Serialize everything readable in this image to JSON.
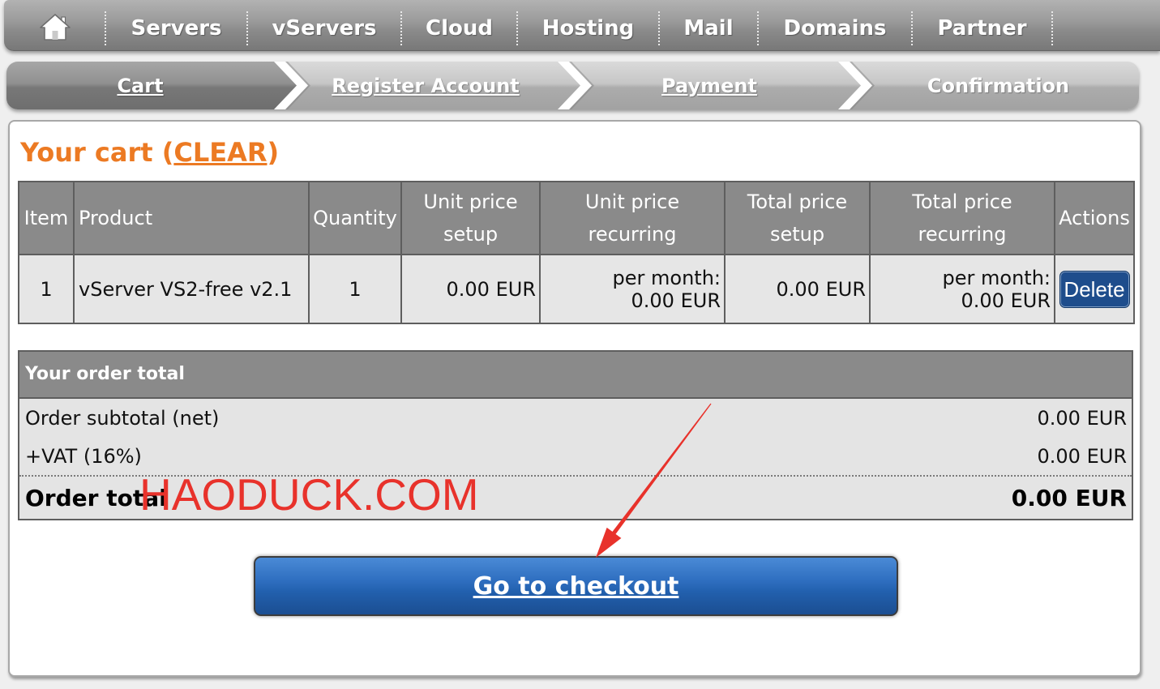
{
  "top_nav": {
    "home": {
      "icon": "home-icon"
    },
    "items": [
      {
        "label": "Servers"
      },
      {
        "label": "vServers"
      },
      {
        "label": "Cloud"
      },
      {
        "label": "Hosting"
      },
      {
        "label": "Mail"
      },
      {
        "label": "Domains"
      },
      {
        "label": "Partner"
      }
    ]
  },
  "checkout_steps": [
    {
      "label": "Cart",
      "active": true,
      "linked": true
    },
    {
      "label": "Register Account",
      "active": false,
      "linked": true
    },
    {
      "label": "Payment",
      "active": false,
      "linked": true
    },
    {
      "label": "Confirmation",
      "active": false,
      "linked": false
    }
  ],
  "cart": {
    "title": "Your cart",
    "clear_open": "(",
    "clear_label": "CLEAR",
    "clear_close": ")",
    "columns": [
      {
        "lines": [
          "Item"
        ]
      },
      {
        "lines": [
          "Product"
        ]
      },
      {
        "lines": [
          "Quantity"
        ]
      },
      {
        "lines": [
          "Unit price",
          "setup"
        ]
      },
      {
        "lines": [
          "Unit price",
          "recurring"
        ]
      },
      {
        "lines": [
          "Total price",
          "setup"
        ]
      },
      {
        "lines": [
          "Total price",
          "recurring"
        ]
      },
      {
        "lines": [
          "Actions"
        ]
      }
    ],
    "rows": [
      {
        "item": "1",
        "product": "vServer VS2-free v2.1",
        "quantity": "1",
        "unit_price_setup": "0.00 EUR",
        "unit_price_recurring": {
          "period": "per month:",
          "amount": "0.00 EUR"
        },
        "total_price_setup": "0.00 EUR",
        "total_price_recurring": {
          "period": "per month:",
          "amount": "0.00 EUR"
        },
        "action_label": "Delete"
      }
    ]
  },
  "order_total": {
    "heading": "Your order total",
    "lines": [
      {
        "label": "Order subtotal (net)",
        "value": "0.00 EUR"
      },
      {
        "label": "+VAT (16%)",
        "value": "0.00 EUR"
      }
    ],
    "total": {
      "label": "Order total",
      "value": "0.00 EUR"
    }
  },
  "checkout_button": {
    "label": "Go to checkout"
  },
  "watermark": {
    "text": "HAODUCK.COM"
  },
  "annotations": [
    {
      "type": "arrow",
      "icon": "arrow-annotation-icon",
      "color": "#e8322b"
    }
  ],
  "colors": {
    "accent_orange": "#ec7a23",
    "table_header_gray": "#8a8a8a",
    "table_row_gray": "#e6e6e6",
    "delete_button_blue": "#1e4d8c",
    "checkout_button_blue": "#2260ae",
    "watermark_red": "#e8322b"
  }
}
